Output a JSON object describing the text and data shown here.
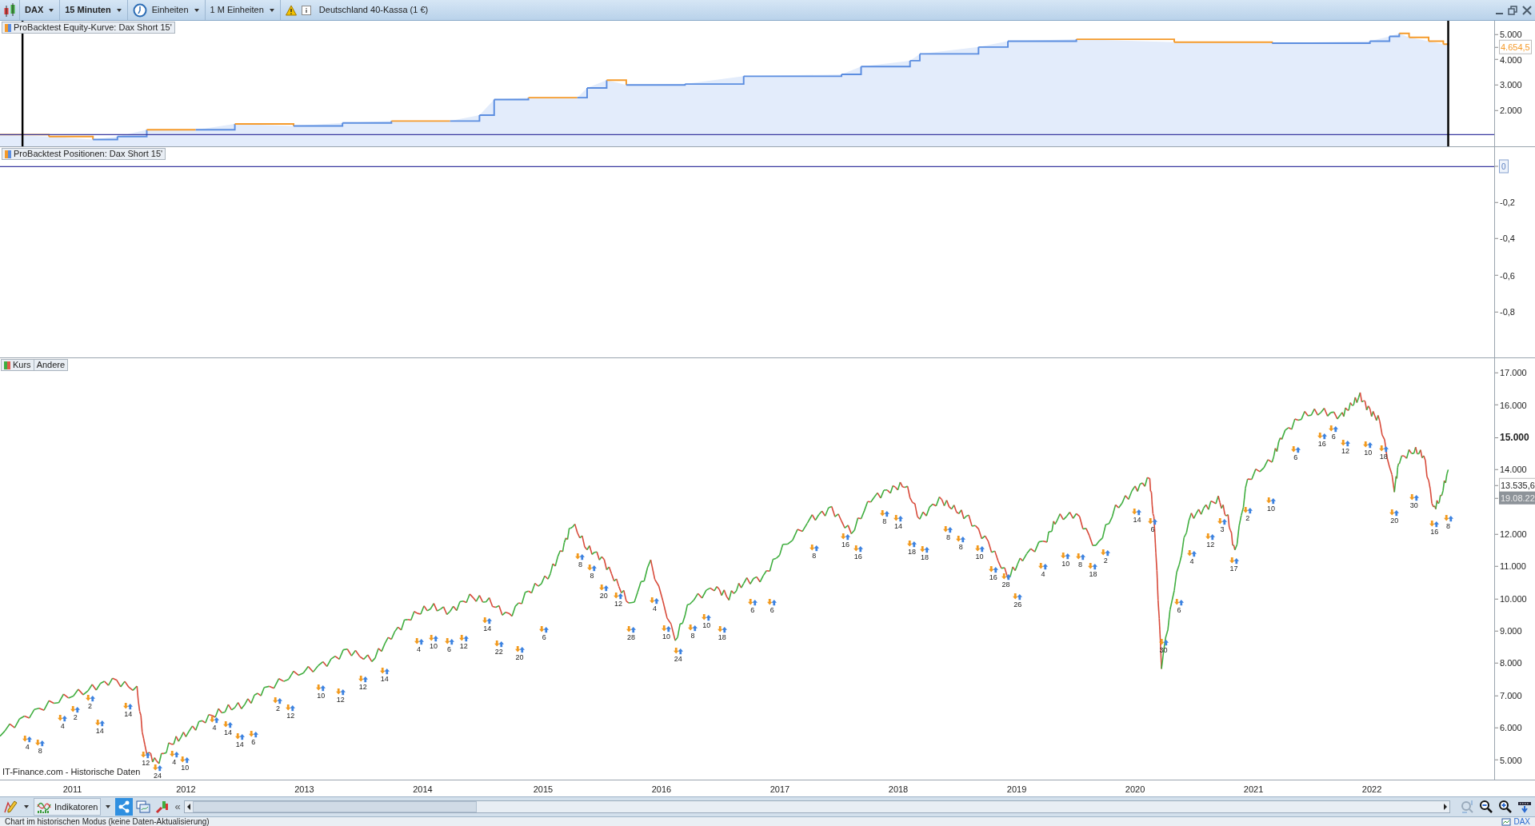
{
  "toolbar": {
    "symbol": "DAX",
    "timeframe": "15 Minuten",
    "units": "Einheiten",
    "units_count": "1 M Einheiten",
    "instrument": "Deutschland 40-Kassa (1 €)"
  },
  "equity_panel": {
    "title": "ProBacktest Equity-Kurve: Dax Short 15'",
    "axis_labels": [
      "5.000",
      "4.000",
      "3.000",
      "2.000"
    ],
    "last_value": "4.654,5"
  },
  "positions_panel": {
    "title": "ProBacktest Positionen: Dax Short 15'",
    "zero_label": "0",
    "axis_labels": [
      "-0,2",
      "-0,4",
      "-0,6",
      "-0,8"
    ]
  },
  "price_panel": {
    "tabs": [
      {
        "label": "Kurs",
        "kind": "legend"
      },
      {
        "label": "Andere",
        "kind": "plain"
      }
    ],
    "axis_labels": [
      {
        "label": "17.000",
        "bold": false
      },
      {
        "label": "16.000",
        "bold": false
      },
      {
        "label": "15.000",
        "bold": true
      },
      {
        "label": "14.000",
        "bold": false
      },
      {
        "label": "12.000",
        "bold": false
      },
      {
        "label": "11.000",
        "bold": false
      },
      {
        "label": "10.000",
        "bold": false
      },
      {
        "label": "9.000",
        "bold": false
      },
      {
        "label": "8.000",
        "bold": false
      },
      {
        "label": "7.000",
        "bold": false
      },
      {
        "label": "6.000",
        "bold": false
      },
      {
        "label": "5.000",
        "bold": false
      }
    ],
    "last_price": "13.535,6",
    "last_date": "19.08.22",
    "source": "IT-Finance.com - Historische Daten",
    "trades": [
      "4",
      "8",
      "4",
      "2",
      "2",
      "14",
      "14",
      "12",
      "24",
      "4",
      "10",
      "4",
      "14",
      "14",
      "6",
      "2",
      "12",
      "10",
      "12",
      "12",
      "14",
      "4",
      "10",
      "6",
      "12",
      "14",
      "22",
      "20",
      "6",
      "8",
      "8",
      "20",
      "12",
      "28",
      "4",
      "10",
      "24",
      "8",
      "10",
      "18",
      "6",
      "6",
      "8",
      "16",
      "16",
      "8",
      "14",
      "18",
      "18",
      "8",
      "8",
      "10",
      "16",
      "28",
      "26",
      "4",
      "10",
      "8",
      "18",
      "2",
      "14",
      "6",
      "30",
      "6",
      "4",
      "12",
      "3",
      "17",
      "2",
      "10",
      "6",
      "16",
      "6",
      "12",
      "10",
      "18",
      "20",
      "30",
      "16",
      "8"
    ]
  },
  "x_axis": [
    "2011",
    "2012",
    "2013",
    "2014",
    "2015",
    "2016",
    "2017",
    "2018",
    "2019",
    "2020",
    "2021",
    "2022"
  ],
  "bottom_toolbar": {
    "indicators": "Indikatoren",
    "collapse": "«"
  },
  "status_bar": {
    "message": "Chart im historischen Modus (keine Daten-Aktualisierung)",
    "symbol": "DAX"
  }
}
